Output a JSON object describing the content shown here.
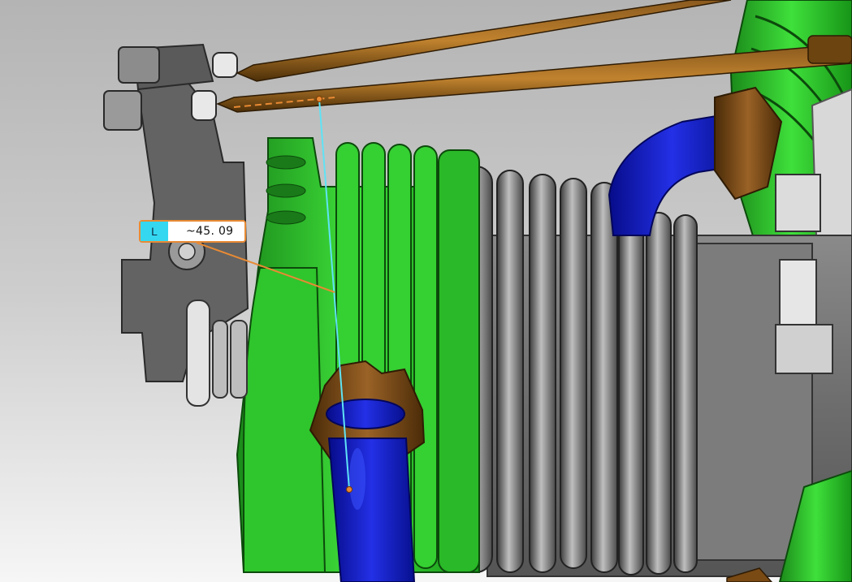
{
  "viewport": {
    "background_top": "#b4b4b4",
    "background_bottom": "#f6f6f6"
  },
  "model": {
    "cylinder_head_color": "#2fc52c",
    "cylinder_body_color": "#6f6f6f",
    "hose_color": "#0b12b8",
    "fitting_color": "#7a4a14",
    "pushrod_color": "#6b4410",
    "bracket_color": "#5a5a5a"
  },
  "measurement": {
    "type_label": "L",
    "value": "~45. 09",
    "accent_color": "#e88a34",
    "line_color": "#5fe3f5",
    "badge_color": "#35d7f0"
  }
}
